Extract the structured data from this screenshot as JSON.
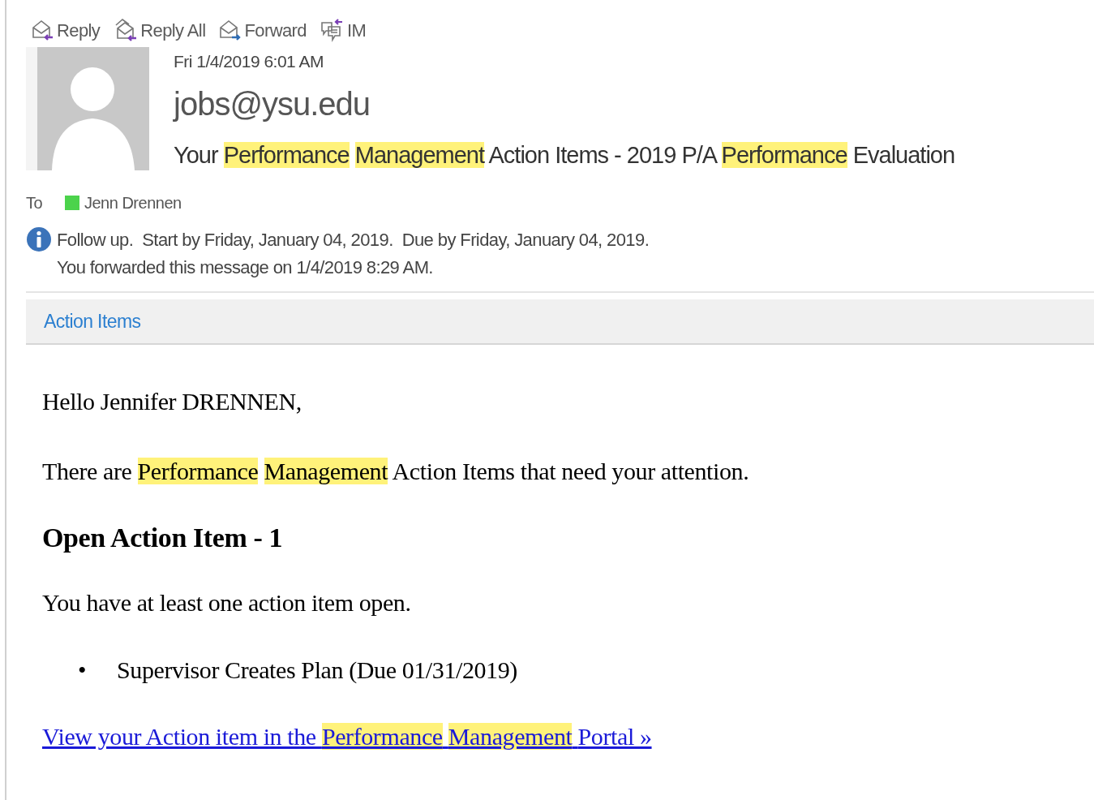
{
  "toolbar": [
    {
      "kind": "reply",
      "label": "Reply"
    },
    {
      "kind": "reply_all",
      "label": "Reply All"
    },
    {
      "kind": "forward",
      "label": "Forward"
    },
    {
      "kind": "im",
      "label": "IM"
    }
  ],
  "message": {
    "date": "Fri 1/4/2019 6:01 AM",
    "sender": "jobs@ysu.edu",
    "subject": [
      {
        "text": "Your ",
        "highlighted": false
      },
      {
        "text": "Performance",
        "highlighted": true
      },
      {
        "text": " Management",
        "highlighted": true
      },
      {
        "text": " Action Items - 2019 P/A ",
        "highlighted": false
      },
      {
        "text": "Performance",
        "highlighted": true
      },
      {
        "text": " Evaluation",
        "highlighted": false
      }
    ],
    "to_label": "To",
    "recipients": [
      {
        "name": "Jenn Drennen",
        "color": "#4cd34c"
      }
    ],
    "info": [
      "Follow up.  Start by Friday, January 04, 2019.  Due by Friday, January 04, 2019.",
      "You forwarded this message on 1/4/2019 8:29 AM."
    ],
    "tabs": [
      {
        "label": "Action Items",
        "selected": true
      }
    ]
  },
  "body": {
    "greeting": "Hello Jennifer DRENNEN,",
    "intro": [
      {
        "text": "There are ",
        "highlighted": false
      },
      {
        "text": "Performance",
        "highlighted": true
      },
      {
        "text": " Management",
        "highlighted": true
      },
      {
        "text": " Action Items that need your attention.",
        "highlighted": false
      }
    ],
    "heading": "Open Action Item - 1",
    "note": "You have at least one action item open.",
    "bullet": "•",
    "items": [
      "Supervisor Creates Plan (Due 01/31/2019)"
    ],
    "link": [
      {
        "text": "View your Action item in the ",
        "highlighted": false
      },
      {
        "text": "Performance",
        "highlighted": true
      },
      {
        "text": " Management",
        "highlighted": true
      },
      {
        "text": " Portal »",
        "highlighted": false
      }
    ]
  }
}
